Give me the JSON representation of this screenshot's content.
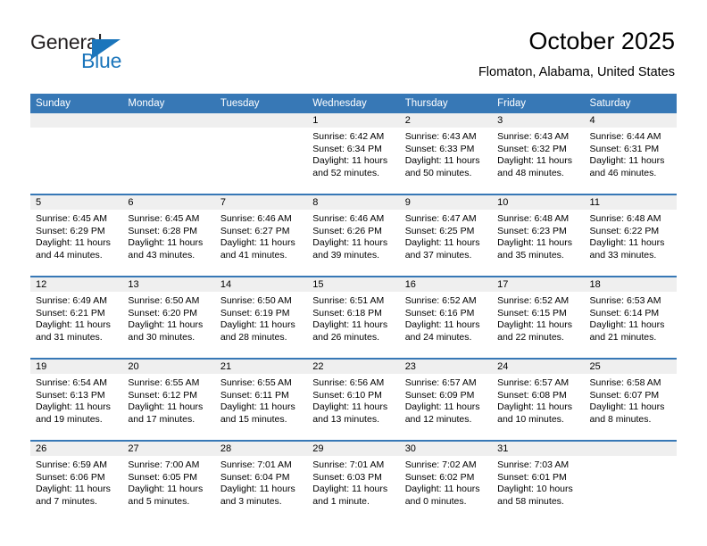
{
  "logo": {
    "word_one": "General",
    "word_two": "Blue",
    "accent_color": "#1b75bb",
    "triangle_icon": "triangle-icon"
  },
  "header": {
    "title": "October 2025",
    "subtitle": "Flomaton, Alabama, United States"
  },
  "theme": {
    "header_row_bg": "#3778b6",
    "day_band_bg": "#efefef",
    "text_color": "#000000"
  },
  "calendar": {
    "weekday_headers": [
      "Sunday",
      "Monday",
      "Tuesday",
      "Wednesday",
      "Thursday",
      "Friday",
      "Saturday"
    ],
    "weeks": [
      [
        {
          "day": "",
          "empty": true
        },
        {
          "day": "",
          "empty": true
        },
        {
          "day": "",
          "empty": true
        },
        {
          "day": "1",
          "sunrise": "Sunrise: 6:42 AM",
          "sunset": "Sunset: 6:34 PM",
          "daylight_line1": "Daylight: 11 hours",
          "daylight_line2": "and 52 minutes."
        },
        {
          "day": "2",
          "sunrise": "Sunrise: 6:43 AM",
          "sunset": "Sunset: 6:33 PM",
          "daylight_line1": "Daylight: 11 hours",
          "daylight_line2": "and 50 minutes."
        },
        {
          "day": "3",
          "sunrise": "Sunrise: 6:43 AM",
          "sunset": "Sunset: 6:32 PM",
          "daylight_line1": "Daylight: 11 hours",
          "daylight_line2": "and 48 minutes."
        },
        {
          "day": "4",
          "sunrise": "Sunrise: 6:44 AM",
          "sunset": "Sunset: 6:31 PM",
          "daylight_line1": "Daylight: 11 hours",
          "daylight_line2": "and 46 minutes."
        }
      ],
      [
        {
          "day": "5",
          "sunrise": "Sunrise: 6:45 AM",
          "sunset": "Sunset: 6:29 PM",
          "daylight_line1": "Daylight: 11 hours",
          "daylight_line2": "and 44 minutes."
        },
        {
          "day": "6",
          "sunrise": "Sunrise: 6:45 AM",
          "sunset": "Sunset: 6:28 PM",
          "daylight_line1": "Daylight: 11 hours",
          "daylight_line2": "and 43 minutes."
        },
        {
          "day": "7",
          "sunrise": "Sunrise: 6:46 AM",
          "sunset": "Sunset: 6:27 PM",
          "daylight_line1": "Daylight: 11 hours",
          "daylight_line2": "and 41 minutes."
        },
        {
          "day": "8",
          "sunrise": "Sunrise: 6:46 AM",
          "sunset": "Sunset: 6:26 PM",
          "daylight_line1": "Daylight: 11 hours",
          "daylight_line2": "and 39 minutes."
        },
        {
          "day": "9",
          "sunrise": "Sunrise: 6:47 AM",
          "sunset": "Sunset: 6:25 PM",
          "daylight_line1": "Daylight: 11 hours",
          "daylight_line2": "and 37 minutes."
        },
        {
          "day": "10",
          "sunrise": "Sunrise: 6:48 AM",
          "sunset": "Sunset: 6:23 PM",
          "daylight_line1": "Daylight: 11 hours",
          "daylight_line2": "and 35 minutes."
        },
        {
          "day": "11",
          "sunrise": "Sunrise: 6:48 AM",
          "sunset": "Sunset: 6:22 PM",
          "daylight_line1": "Daylight: 11 hours",
          "daylight_line2": "and 33 minutes."
        }
      ],
      [
        {
          "day": "12",
          "sunrise": "Sunrise: 6:49 AM",
          "sunset": "Sunset: 6:21 PM",
          "daylight_line1": "Daylight: 11 hours",
          "daylight_line2": "and 31 minutes."
        },
        {
          "day": "13",
          "sunrise": "Sunrise: 6:50 AM",
          "sunset": "Sunset: 6:20 PM",
          "daylight_line1": "Daylight: 11 hours",
          "daylight_line2": "and 30 minutes."
        },
        {
          "day": "14",
          "sunrise": "Sunrise: 6:50 AM",
          "sunset": "Sunset: 6:19 PM",
          "daylight_line1": "Daylight: 11 hours",
          "daylight_line2": "and 28 minutes."
        },
        {
          "day": "15",
          "sunrise": "Sunrise: 6:51 AM",
          "sunset": "Sunset: 6:18 PM",
          "daylight_line1": "Daylight: 11 hours",
          "daylight_line2": "and 26 minutes."
        },
        {
          "day": "16",
          "sunrise": "Sunrise: 6:52 AM",
          "sunset": "Sunset: 6:16 PM",
          "daylight_line1": "Daylight: 11 hours",
          "daylight_line2": "and 24 minutes."
        },
        {
          "day": "17",
          "sunrise": "Sunrise: 6:52 AM",
          "sunset": "Sunset: 6:15 PM",
          "daylight_line1": "Daylight: 11 hours",
          "daylight_line2": "and 22 minutes."
        },
        {
          "day": "18",
          "sunrise": "Sunrise: 6:53 AM",
          "sunset": "Sunset: 6:14 PM",
          "daylight_line1": "Daylight: 11 hours",
          "daylight_line2": "and 21 minutes."
        }
      ],
      [
        {
          "day": "19",
          "sunrise": "Sunrise: 6:54 AM",
          "sunset": "Sunset: 6:13 PM",
          "daylight_line1": "Daylight: 11 hours",
          "daylight_line2": "and 19 minutes."
        },
        {
          "day": "20",
          "sunrise": "Sunrise: 6:55 AM",
          "sunset": "Sunset: 6:12 PM",
          "daylight_line1": "Daylight: 11 hours",
          "daylight_line2": "and 17 minutes."
        },
        {
          "day": "21",
          "sunrise": "Sunrise: 6:55 AM",
          "sunset": "Sunset: 6:11 PM",
          "daylight_line1": "Daylight: 11 hours",
          "daylight_line2": "and 15 minutes."
        },
        {
          "day": "22",
          "sunrise": "Sunrise: 6:56 AM",
          "sunset": "Sunset: 6:10 PM",
          "daylight_line1": "Daylight: 11 hours",
          "daylight_line2": "and 13 minutes."
        },
        {
          "day": "23",
          "sunrise": "Sunrise: 6:57 AM",
          "sunset": "Sunset: 6:09 PM",
          "daylight_line1": "Daylight: 11 hours",
          "daylight_line2": "and 12 minutes."
        },
        {
          "day": "24",
          "sunrise": "Sunrise: 6:57 AM",
          "sunset": "Sunset: 6:08 PM",
          "daylight_line1": "Daylight: 11 hours",
          "daylight_line2": "and 10 minutes."
        },
        {
          "day": "25",
          "sunrise": "Sunrise: 6:58 AM",
          "sunset": "Sunset: 6:07 PM",
          "daylight_line1": "Daylight: 11 hours",
          "daylight_line2": "and 8 minutes."
        }
      ],
      [
        {
          "day": "26",
          "sunrise": "Sunrise: 6:59 AM",
          "sunset": "Sunset: 6:06 PM",
          "daylight_line1": "Daylight: 11 hours",
          "daylight_line2": "and 7 minutes."
        },
        {
          "day": "27",
          "sunrise": "Sunrise: 7:00 AM",
          "sunset": "Sunset: 6:05 PM",
          "daylight_line1": "Daylight: 11 hours",
          "daylight_line2": "and 5 minutes."
        },
        {
          "day": "28",
          "sunrise": "Sunrise: 7:01 AM",
          "sunset": "Sunset: 6:04 PM",
          "daylight_line1": "Daylight: 11 hours",
          "daylight_line2": "and 3 minutes."
        },
        {
          "day": "29",
          "sunrise": "Sunrise: 7:01 AM",
          "sunset": "Sunset: 6:03 PM",
          "daylight_line1": "Daylight: 11 hours",
          "daylight_line2": "and 1 minute."
        },
        {
          "day": "30",
          "sunrise": "Sunrise: 7:02 AM",
          "sunset": "Sunset: 6:02 PM",
          "daylight_line1": "Daylight: 11 hours",
          "daylight_line2": "and 0 minutes."
        },
        {
          "day": "31",
          "sunrise": "Sunrise: 7:03 AM",
          "sunset": "Sunset: 6:01 PM",
          "daylight_line1": "Daylight: 10 hours",
          "daylight_line2": "and 58 minutes."
        },
        {
          "day": "",
          "empty": true
        }
      ]
    ]
  }
}
